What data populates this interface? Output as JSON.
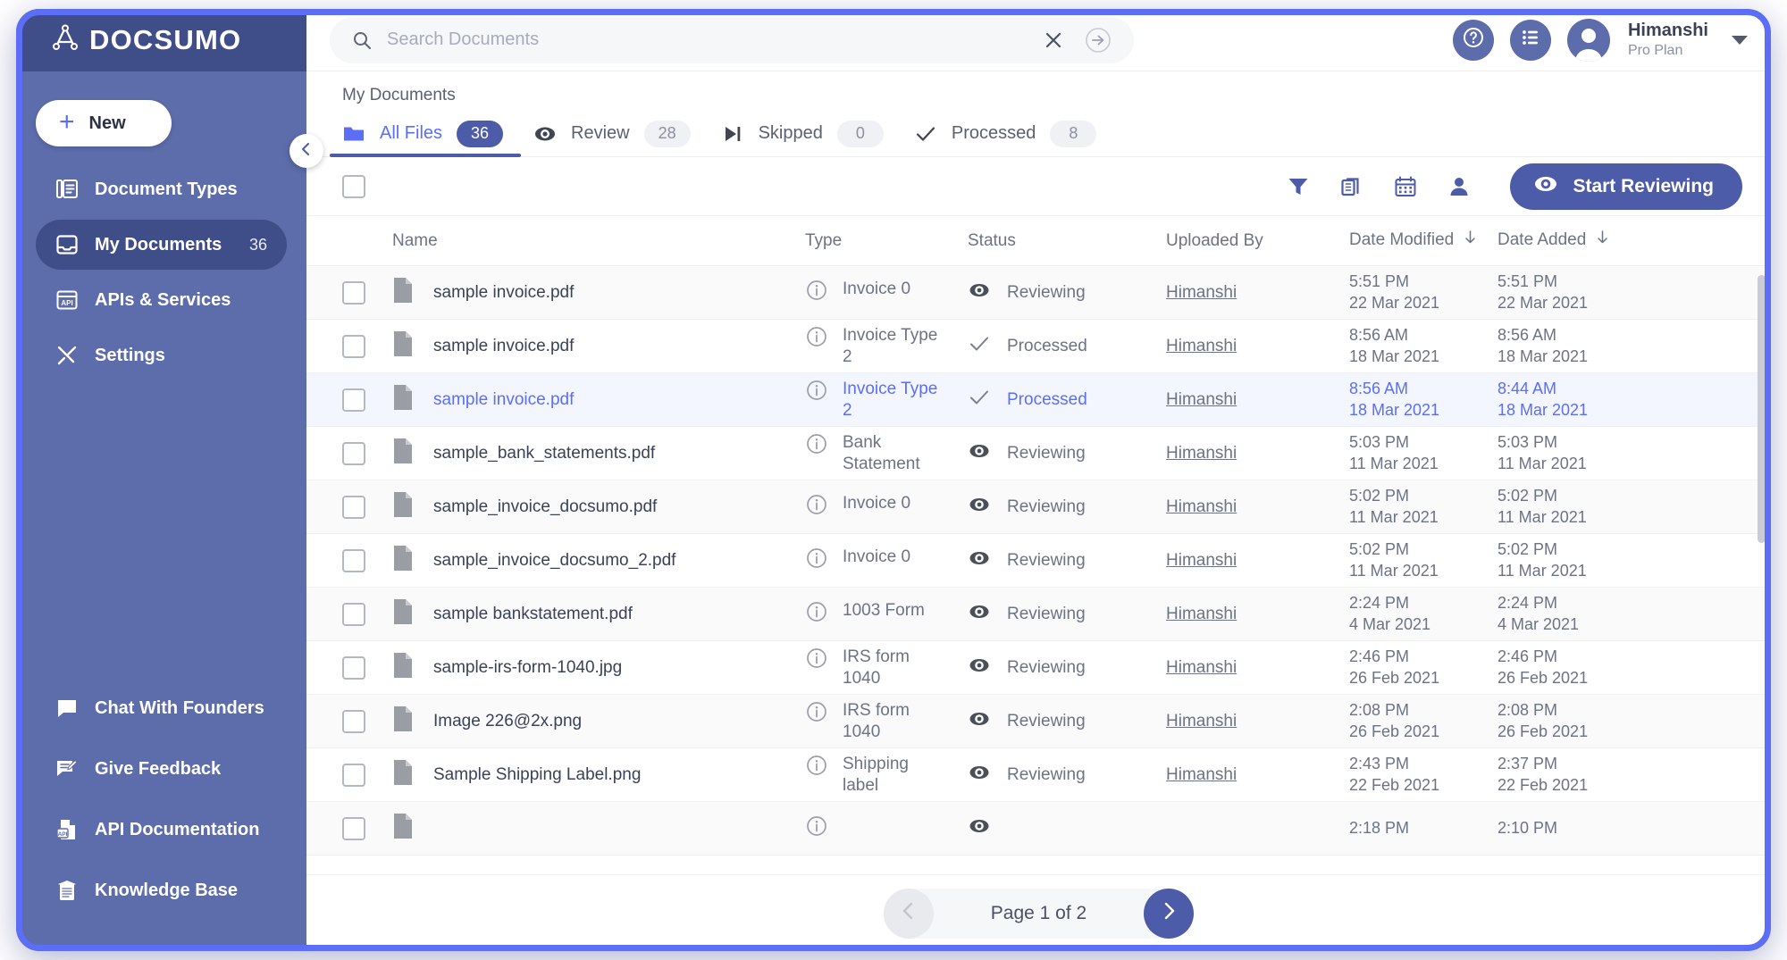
{
  "brand": {
    "name": "DOCSUMO",
    "logo_icon": "docsumo-logo-icon"
  },
  "sidebar": {
    "new_button": {
      "label": "New",
      "icon": "plus-icon"
    },
    "items": [
      {
        "label": "Document Types",
        "icon": "documents-icon",
        "count": "",
        "active": false
      },
      {
        "label": "My Documents",
        "icon": "inbox-icon",
        "count": "36",
        "active": true
      },
      {
        "label": "APIs & Services",
        "icon": "api-icon",
        "count": "",
        "active": false
      },
      {
        "label": "Settings",
        "icon": "tools-icon",
        "count": "",
        "active": false
      }
    ],
    "bottom_items": [
      {
        "label": "Chat With Founders",
        "icon": "chat-icon"
      },
      {
        "label": "Give Feedback",
        "icon": "feedback-icon"
      },
      {
        "label": "API Documentation",
        "icon": "api-doc-icon"
      },
      {
        "label": "Knowledge Base",
        "icon": "knowledge-base-icon"
      }
    ],
    "collapse_icon": "chevron-left-icon"
  },
  "header": {
    "search": {
      "placeholder": "Search Documents",
      "value": "",
      "search_icon": "search-icon",
      "clear_icon": "close-x-icon",
      "submit_icon": "arrow-right-circle-icon"
    },
    "help_icon": "help-circle-icon",
    "list_icon": "list-icon",
    "avatar_icon": "user-avatar-icon",
    "user_name": "Himanshi",
    "user_plan": "Pro Plan",
    "caret_icon": "chevron-down-icon"
  },
  "breadcrumb": "My Documents",
  "tabs": [
    {
      "label": "All Files",
      "count": "36",
      "icon": "folder-icon",
      "active": true
    },
    {
      "label": "Review",
      "count": "28",
      "icon": "eye-icon",
      "active": false
    },
    {
      "label": "Skipped",
      "count": "0",
      "icon": "skip-forward-icon",
      "active": false
    },
    {
      "label": "Processed",
      "count": "8",
      "icon": "check-icon",
      "active": false
    }
  ],
  "toolbar": {
    "select_all_checkbox": "unchecked",
    "icons": [
      {
        "name": "filter-icon"
      },
      {
        "name": "copy-documents-icon"
      },
      {
        "name": "calendar-icon"
      },
      {
        "name": "person-icon"
      }
    ],
    "start_reviewing_label": "Start Reviewing",
    "start_reviewing_icon": "eye-icon"
  },
  "table": {
    "columns": [
      {
        "label": "Name",
        "sort_icon": ""
      },
      {
        "label": "Type",
        "sort_icon": ""
      },
      {
        "label": "Status",
        "sort_icon": ""
      },
      {
        "label": "Uploaded By",
        "sort_icon": ""
      },
      {
        "label": "Date Modified",
        "sort_icon": "arrow-down-icon"
      },
      {
        "label": "Date Added",
        "sort_icon": "arrow-down-icon"
      }
    ],
    "rows": [
      {
        "name": "sample invoice.pdf",
        "type": "Invoice 0",
        "status": "Reviewing",
        "status_icon": "eye-icon",
        "uploaded_by": "Himanshi",
        "date_modified_time": "5:51 PM",
        "date_modified_date": "22 Mar 2021",
        "date_added_time": "5:51 PM",
        "date_added_date": "22 Mar 2021",
        "selected": false
      },
      {
        "name": "sample invoice.pdf",
        "type": "Invoice Type 2",
        "status": "Processed",
        "status_icon": "check-icon",
        "uploaded_by": "Himanshi",
        "date_modified_time": "8:56 AM",
        "date_modified_date": "18 Mar 2021",
        "date_added_time": "8:56 AM",
        "date_added_date": "18 Mar 2021",
        "selected": false
      },
      {
        "name": "sample invoice.pdf",
        "type": "Invoice Type 2",
        "status": "Processed",
        "status_icon": "check-icon",
        "uploaded_by": "Himanshi",
        "date_modified_time": "8:56 AM",
        "date_modified_date": "18 Mar 2021",
        "date_added_time": "8:44 AM",
        "date_added_date": "18 Mar 2021",
        "selected": true
      },
      {
        "name": "sample_bank_statements.pdf",
        "type": "Bank Statement",
        "status": "Reviewing",
        "status_icon": "eye-icon",
        "uploaded_by": "Himanshi",
        "date_modified_time": "5:03 PM",
        "date_modified_date": "11 Mar 2021",
        "date_added_time": "5:03 PM",
        "date_added_date": "11 Mar 2021",
        "selected": false
      },
      {
        "name": "sample_invoice_docsumo.pdf",
        "type": "Invoice 0",
        "status": "Reviewing",
        "status_icon": "eye-icon",
        "uploaded_by": "Himanshi",
        "date_modified_time": "5:02 PM",
        "date_modified_date": "11 Mar 2021",
        "date_added_time": "5:02 PM",
        "date_added_date": "11 Mar 2021",
        "selected": false
      },
      {
        "name": "sample_invoice_docsumo_2.pdf",
        "type": "Invoice 0",
        "status": "Reviewing",
        "status_icon": "eye-icon",
        "uploaded_by": "Himanshi",
        "date_modified_time": "5:02 PM",
        "date_modified_date": "11 Mar 2021",
        "date_added_time": "5:02 PM",
        "date_added_date": "11 Mar 2021",
        "selected": false
      },
      {
        "name": "sample bankstatement.pdf",
        "type": "1003 Form",
        "status": "Reviewing",
        "status_icon": "eye-icon",
        "uploaded_by": "Himanshi",
        "date_modified_time": "2:24 PM",
        "date_modified_date": "4 Mar 2021",
        "date_added_time": "2:24 PM",
        "date_added_date": "4 Mar 2021",
        "selected": false
      },
      {
        "name": "sample-irs-form-1040.jpg",
        "type": "IRS form 1040",
        "status": "Reviewing",
        "status_icon": "eye-icon",
        "uploaded_by": "Himanshi",
        "date_modified_time": "2:46 PM",
        "date_modified_date": "26 Feb 2021",
        "date_added_time": "2:46 PM",
        "date_added_date": "26 Feb 2021",
        "selected": false
      },
      {
        "name": "Image 226@2x.png",
        "type": "IRS form 1040",
        "status": "Reviewing",
        "status_icon": "eye-icon",
        "uploaded_by": "Himanshi",
        "date_modified_time": "2:08 PM",
        "date_modified_date": "26 Feb 2021",
        "date_added_time": "2:08 PM",
        "date_added_date": "26 Feb 2021",
        "selected": false
      },
      {
        "name": "Sample Shipping Label.png",
        "type": "Shipping label",
        "status": "Reviewing",
        "status_icon": "eye-icon",
        "uploaded_by": "Himanshi",
        "date_modified_time": "2:43 PM",
        "date_modified_date": "22 Feb 2021",
        "date_added_time": "2:37 PM",
        "date_added_date": "22 Feb 2021",
        "selected": false
      },
      {
        "name": "",
        "type": "",
        "status": "",
        "status_icon": "eye-icon",
        "uploaded_by": "",
        "date_modified_time": "2:18 PM",
        "date_modified_date": "",
        "date_added_time": "2:10 PM",
        "date_added_date": "",
        "selected": false
      }
    ]
  },
  "pagination": {
    "text": "Page 1 of 2",
    "prev_icon": "chevron-left-icon",
    "next_icon": "chevron-right-icon"
  },
  "colors": {
    "accent": "#5b6ef5",
    "sidebar": "#5d6cab",
    "sidebar_dark": "#3f4d89",
    "button": "#4d5ca8"
  }
}
